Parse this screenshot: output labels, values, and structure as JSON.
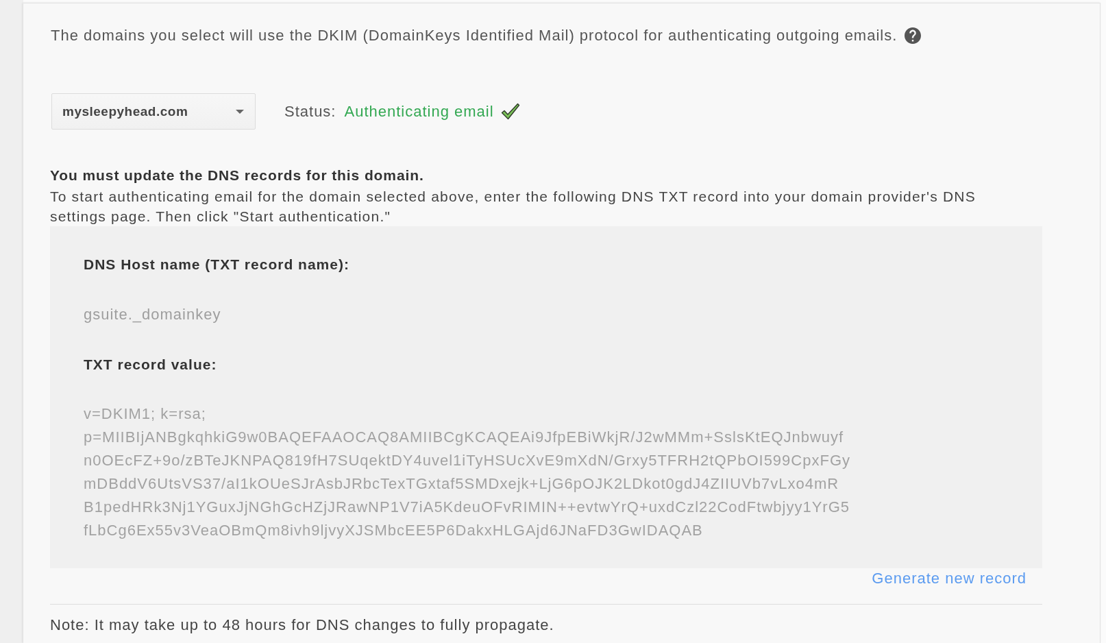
{
  "intro": {
    "text": "The domains you select will use the DKIM (DomainKeys Identified Mail) protocol for authenticating outgoing emails."
  },
  "domain_select": {
    "value": "mysleepyhead.com"
  },
  "status": {
    "label": "Status:",
    "value": "Authenticating email",
    "authenticated": true
  },
  "dns_notice": {
    "heading": "You must update the DNS records for this domain.",
    "text": "To start authenticating email for the domain selected above, enter the following DNS TXT record into your domain provider's DNS settings page. Then click \"Start authentication.\""
  },
  "record": {
    "host_label": "DNS Host name (TXT record name):",
    "host_value": "gsuite._domainkey",
    "value_label": "TXT record value:",
    "value_lines": [
      "v=DKIM1; k=rsa;",
      "p=MIIBIjANBgkqhkiG9w0BAQEFAAOCAQ8AMIIBCgKCAQEAi9JfpEBiWkjR/J2wMMm+SslsKtEQJnbwuyf",
      "n0OEcFZ+9o/zBTeJKNPAQ819fH7SUqektDY4uvel1iTyHSUcXvE9mXdN/Grxy5TFRH2tQPbOI599CpxFGy",
      "mDBddV6UtsVS37/aI1kOUeSJrAsbJRbcTexTGxtaf5SMDxejk+LjG6pOJK2LDkot0gdJ4ZIIUVb7vLxo4mR",
      "B1pedHRk3Nj1YGuxJjNGhGcHZjJRawNP1V7iA5KdeuOFvRIMIN++evtwYrQ+uxdCzl22CodFtwbjyy1YrG5",
      "fLbCg6Ex55v3VeaOBmQm8ivh9ljvyXJSMbcEE5P6DakxHLGAjd6JNaFD3GwIDAQAB"
    ]
  },
  "generate_link": "Generate new record",
  "note": "Note: It may take up to 48 hours for DNS changes to fully propagate."
}
